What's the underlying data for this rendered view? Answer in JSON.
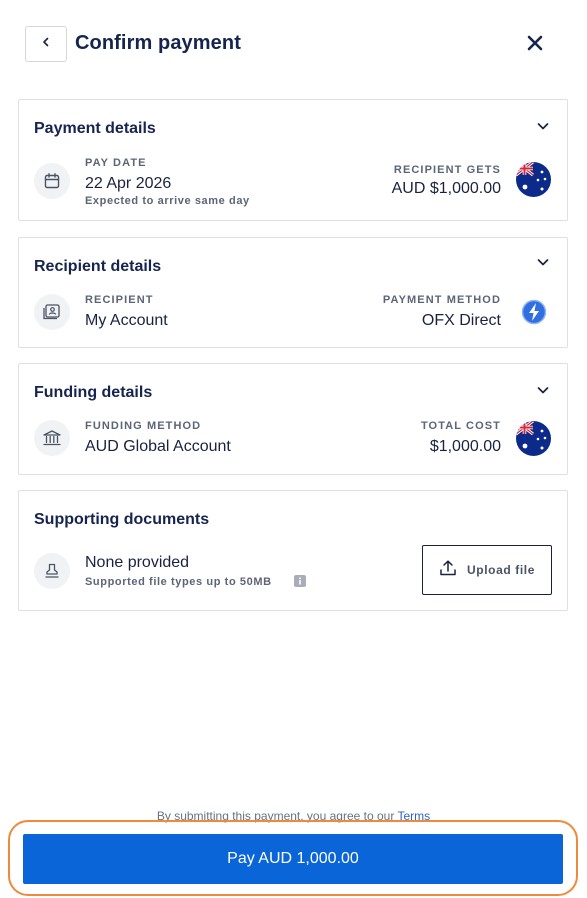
{
  "header": {
    "title": "Confirm payment",
    "back_icon": "chevron-left-icon",
    "close_icon": "close-icon"
  },
  "payment_details": {
    "title": "Payment details",
    "pay_date_label": "PAY DATE",
    "pay_date": "22 Apr 2026",
    "arrival_note": "Expected to arrive same day",
    "recipient_gets_label": "RECIPIENT GETS",
    "recipient_gets": "AUD $1,000.00",
    "flag": "australia-flag-icon"
  },
  "recipient_details": {
    "title": "Recipient details",
    "recipient_label": "RECIPIENT",
    "recipient": "My Account",
    "payment_method_label": "PAYMENT METHOD",
    "payment_method": "OFX Direct"
  },
  "funding_details": {
    "title": "Funding details",
    "funding_method_label": "FUNDING METHOD",
    "funding_method": "AUD Global Account",
    "total_cost_label": "TOTAL COST",
    "total_cost": "$1,000.00"
  },
  "supporting_documents": {
    "title": "Supporting documents",
    "status": "None provided",
    "note": "Supported file types up to 50MB",
    "upload_label": "Upload file"
  },
  "footer": {
    "agreement_text": "By submitting this payment, you agree to our",
    "terms_link": "Terms",
    "pay_button": "Pay AUD 1,000.00"
  },
  "colors": {
    "primary": "#0a66d8",
    "heading": "#16254f",
    "focus_outline": "#ef8a3c"
  }
}
